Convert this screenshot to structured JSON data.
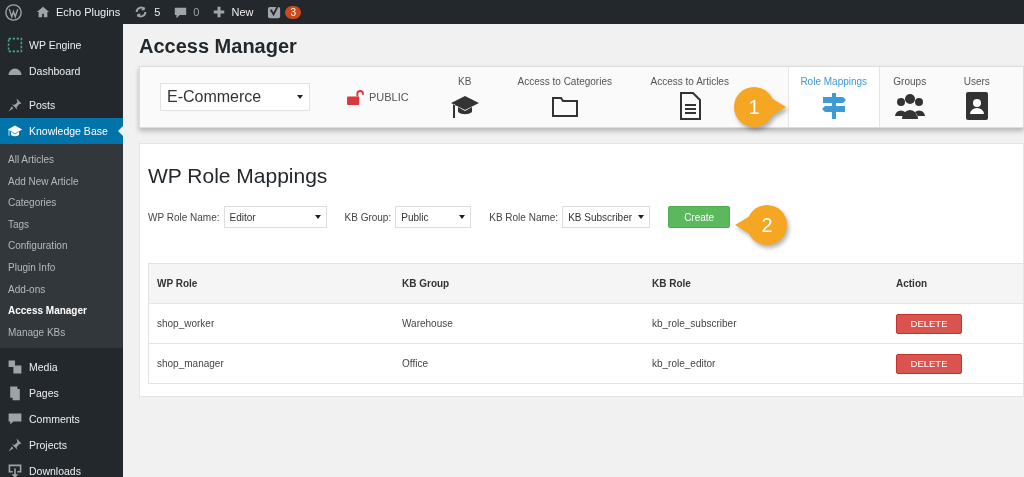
{
  "admin_bar": {
    "site": "Echo Plugins",
    "updates": "5",
    "comments": "0",
    "new": "New",
    "seo_badge": "3"
  },
  "sidebar": {
    "items": [
      {
        "label": "WP Engine",
        "kind": "grid",
        "selected": false
      },
      {
        "label": "Dashboard",
        "kind": "gauge",
        "selected": false
      },
      {
        "label": "Posts",
        "kind": "pin",
        "selected": false
      },
      {
        "label": "Knowledge Base",
        "kind": "cap",
        "selected": true,
        "children": [
          {
            "label": "All Articles",
            "selected": false
          },
          {
            "label": "Add New Article",
            "selected": false
          },
          {
            "label": "Categories",
            "selected": false
          },
          {
            "label": "Tags",
            "selected": false
          },
          {
            "label": "Configuration",
            "selected": false
          },
          {
            "label": "Plugin Info",
            "selected": false
          },
          {
            "label": "Add-ons",
            "selected": false
          },
          {
            "label": "Access Manager",
            "selected": true
          },
          {
            "label": "Manage KBs",
            "selected": false
          }
        ]
      },
      {
        "label": "Media",
        "kind": "media",
        "selected": false
      },
      {
        "label": "Pages",
        "kind": "pages",
        "selected": false
      },
      {
        "label": "Comments",
        "kind": "bubble",
        "selected": false
      },
      {
        "label": "Projects",
        "kind": "pin",
        "selected": false
      },
      {
        "label": "Downloads",
        "kind": "download",
        "selected": false
      }
    ]
  },
  "page_title": "Access Manager",
  "toolbar": {
    "kb_select": "E-Commerce",
    "access_badge": "PUBLIC",
    "tabs": [
      {
        "label": "KB",
        "kind": "cap",
        "selected": false
      },
      {
        "label": "Access to Categories",
        "kind": "folder",
        "selected": false
      },
      {
        "label": "Access to Articles",
        "kind": "document",
        "selected": false
      },
      {
        "label": "Role Mappings",
        "kind": "signpost",
        "selected": true
      },
      {
        "label": "Groups",
        "kind": "group",
        "selected": false
      },
      {
        "label": "Users",
        "kind": "contact",
        "selected": false
      }
    ]
  },
  "callouts": [
    "1",
    "2"
  ],
  "panel": {
    "heading": "WP Role Mappings",
    "form": [
      {
        "label": "WP Role Name:",
        "value": "Editor"
      },
      {
        "label": "KB Group:",
        "value": "Public"
      },
      {
        "label": "KB Role Name:",
        "value": "KB Subscriber"
      }
    ],
    "create_button": "Create",
    "table": {
      "columns": [
        "WP Role",
        "KB Group",
        "KB Role",
        "Action"
      ],
      "rows": [
        {
          "wp_role": "shop_worker",
          "kb_group": "Warehouse",
          "kb_role": "kb_role_subscriber",
          "action": "DELETE"
        },
        {
          "wp_role": "shop_manager",
          "kb_group": "Office",
          "kb_role": "kb_role_editor",
          "action": "DELETE"
        }
      ]
    }
  }
}
